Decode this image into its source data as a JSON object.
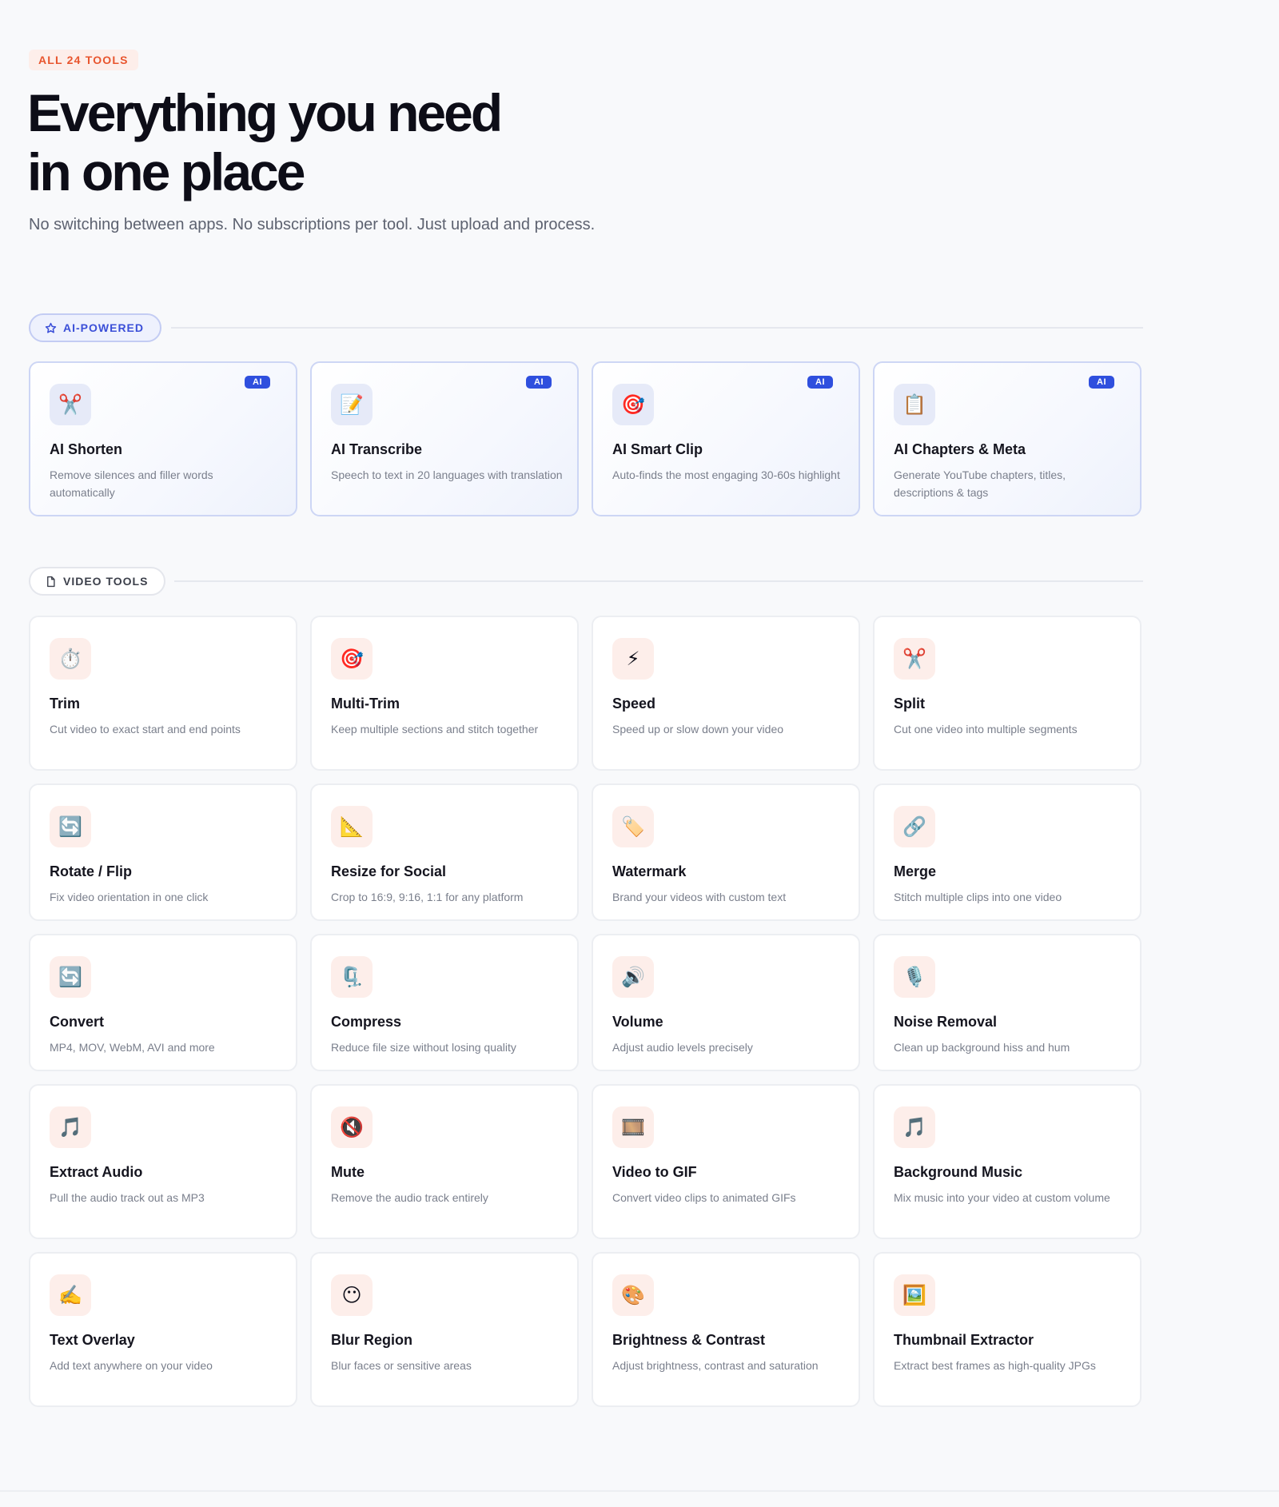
{
  "hero": {
    "eyebrow": "ALL 24 TOOLS",
    "title_line1": "Everything you need",
    "title_line2": "in one place",
    "subtitle": "No switching between apps. No subscriptions per tool. Just upload and process."
  },
  "ai_section": {
    "pill_label": "AI-POWERED",
    "pill_icon": "star-icon",
    "badge_label": "AI",
    "cards": [
      {
        "icon": "✂️",
        "icon_name": "scissors-icon",
        "title": "AI Shorten",
        "desc": "Remove silences and filler words automatically"
      },
      {
        "icon": "📝",
        "icon_name": "memo-icon",
        "title": "AI Transcribe",
        "desc": "Speech to text in 20 languages with translation"
      },
      {
        "icon": "🎯",
        "icon_name": "target-icon",
        "title": "AI Smart Clip",
        "desc": "Auto-finds the most engaging 30-60s highlight"
      },
      {
        "icon": "📋",
        "icon_name": "clipboard-icon",
        "title": "AI Chapters & Meta",
        "desc": "Generate YouTube chapters, titles, descriptions & tags"
      }
    ]
  },
  "video_section": {
    "pill_label": "VIDEO TOOLS",
    "pill_icon": "file-icon",
    "cards": [
      {
        "icon": "⏱️",
        "icon_name": "stopwatch-icon",
        "title": "Trim",
        "desc": "Cut video to exact start and end points"
      },
      {
        "icon": "🎯",
        "icon_name": "target-icon",
        "title": "Multi-Trim",
        "desc": "Keep multiple sections and stitch together"
      },
      {
        "icon": "⚡",
        "icon_name": "lightning-icon",
        "title": "Speed",
        "desc": "Speed up or slow down your video"
      },
      {
        "icon": "✂️",
        "icon_name": "scissors-icon",
        "title": "Split",
        "desc": "Cut one video into multiple segments"
      },
      {
        "icon": "🔄",
        "icon_name": "rotate-icon",
        "title": "Rotate / Flip",
        "desc": "Fix video orientation in one click"
      },
      {
        "icon": "📐",
        "icon_name": "triangle-ruler-icon",
        "title": "Resize for Social",
        "desc": "Crop to 16:9, 9:16, 1:1 for any platform"
      },
      {
        "icon": "🏷️",
        "icon_name": "tag-icon",
        "title": "Watermark",
        "desc": "Brand your videos with custom text"
      },
      {
        "icon": "🔗",
        "icon_name": "link-icon",
        "title": "Merge",
        "desc": "Stitch multiple clips into one video"
      },
      {
        "icon": "🔄",
        "icon_name": "convert-icon",
        "title": "Convert",
        "desc": "MP4, MOV, WebM, AVI and more"
      },
      {
        "icon": "🗜️",
        "icon_name": "clamp-icon",
        "title": "Compress",
        "desc": "Reduce file size without losing quality"
      },
      {
        "icon": "🔊",
        "icon_name": "speaker-icon",
        "title": "Volume",
        "desc": "Adjust audio levels precisely"
      },
      {
        "icon": "🎙️",
        "icon_name": "microphone-icon",
        "title": "Noise Removal",
        "desc": "Clean up background hiss and hum"
      },
      {
        "icon": "🎵",
        "icon_name": "music-note-icon",
        "title": "Extract Audio",
        "desc": "Pull the audio track out as MP3"
      },
      {
        "icon": "🔇",
        "icon_name": "mute-icon",
        "title": "Mute",
        "desc": "Remove the audio track entirely"
      },
      {
        "icon": "🎞️",
        "icon_name": "film-frames-icon",
        "title": "Video to GIF",
        "desc": "Convert video clips to animated GIFs"
      },
      {
        "icon": "🎵",
        "icon_name": "music-note-icon",
        "title": "Background Music",
        "desc": "Mix music into your video at custom volume"
      },
      {
        "icon": "✍️",
        "icon_name": "writing-hand-icon",
        "title": "Text Overlay",
        "desc": "Add text anywhere on your video"
      },
      {
        "icon": "😶",
        "icon_name": "blurred-face-icon",
        "title": "Blur Region",
        "desc": "Blur faces or sensitive areas"
      },
      {
        "icon": "🎨",
        "icon_name": "palette-icon",
        "title": "Brightness & Contrast",
        "desc": "Adjust brightness, contrast and saturation"
      },
      {
        "icon": "🖼️",
        "icon_name": "framed-picture-icon",
        "title": "Thumbnail Extractor",
        "desc": "Extract best frames as high-quality JPGs"
      }
    ]
  },
  "colors": {
    "accent": "#e8552e",
    "ai_blue": "#2f4fde",
    "background": "#f8f9fb"
  }
}
